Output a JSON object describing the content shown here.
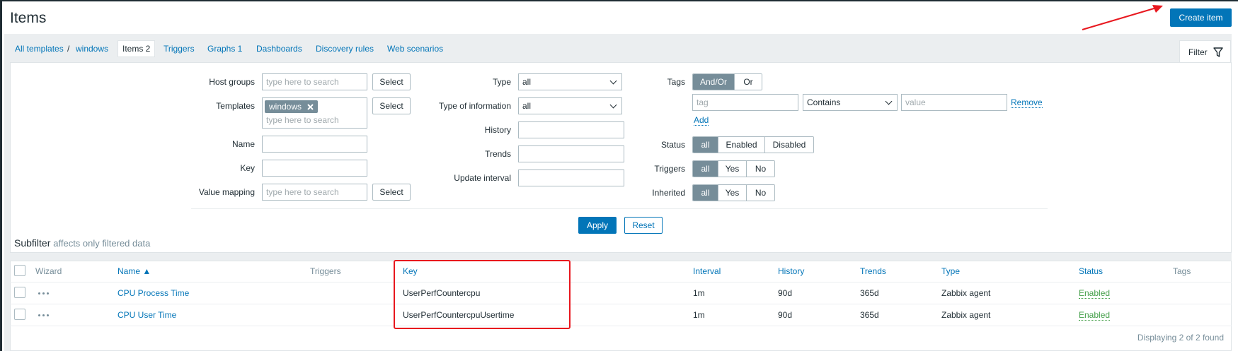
{
  "page": {
    "title": "Items",
    "create_button": "Create item"
  },
  "breadcrumbs": [
    {
      "label": "All templates"
    },
    {
      "label": "/"
    },
    {
      "label": "windows"
    }
  ],
  "tabs": [
    {
      "label": "Items 2",
      "active": true
    },
    {
      "label": "Triggers"
    },
    {
      "label": "Graphs 1"
    },
    {
      "label": "Dashboards"
    },
    {
      "label": "Discovery rules"
    },
    {
      "label": "Web scenarios"
    }
  ],
  "filter": {
    "tab_label": "Filter",
    "host_groups": {
      "label": "Host groups",
      "placeholder": "type here to search",
      "button": "Select"
    },
    "templates": {
      "label": "Templates",
      "chip": "windows",
      "placeholder": "type here to search",
      "button": "Select"
    },
    "name": {
      "label": "Name",
      "value": ""
    },
    "key": {
      "label": "Key",
      "value": ""
    },
    "value_mapping": {
      "label": "Value mapping",
      "placeholder": "type here to search",
      "button": "Select"
    },
    "type": {
      "label": "Type",
      "value": "all"
    },
    "type_of_information": {
      "label": "Type of information",
      "value": "all"
    },
    "history": {
      "label": "History",
      "value": ""
    },
    "trends": {
      "label": "Trends",
      "value": ""
    },
    "update_interval": {
      "label": "Update interval",
      "value": ""
    },
    "tags": {
      "label": "Tags",
      "options": [
        "And/Or",
        "Or"
      ],
      "tag_placeholder": "tag",
      "operator": "Contains",
      "value_placeholder": "value",
      "remove": "Remove",
      "add": "Add"
    },
    "status": {
      "label": "Status",
      "options": [
        "all",
        "Enabled",
        "Disabled"
      ]
    },
    "triggers": {
      "label": "Triggers",
      "options": [
        "all",
        "Yes",
        "No"
      ]
    },
    "inherited": {
      "label": "Inherited",
      "options": [
        "all",
        "Yes",
        "No"
      ]
    },
    "apply": "Apply",
    "reset": "Reset"
  },
  "subfilter": {
    "title": "Subfilter",
    "note": "affects only filtered data"
  },
  "table": {
    "headers": [
      "Wizard",
      "Name ▲",
      "Triggers",
      "Key",
      "Interval",
      "History",
      "Trends",
      "Type",
      "Status",
      "Tags"
    ],
    "rows": [
      {
        "name": "CPU Process Time",
        "triggers": "",
        "key": "UserPerfCountercpu",
        "interval": "1m",
        "history": "90d",
        "trends": "365d",
        "type": "Zabbix agent",
        "status": "Enabled"
      },
      {
        "name": "CPU User Time",
        "triggers": "",
        "key": "UserPerfCountercpuUsertime",
        "interval": "1m",
        "history": "90d",
        "trends": "365d",
        "type": "Zabbix agent",
        "status": "Enabled"
      }
    ],
    "footer": "Displaying 2 of 2 found"
  },
  "colors": {
    "accent": "#0275b8",
    "annotation": "#e8171e",
    "enabled": "#429e47"
  }
}
